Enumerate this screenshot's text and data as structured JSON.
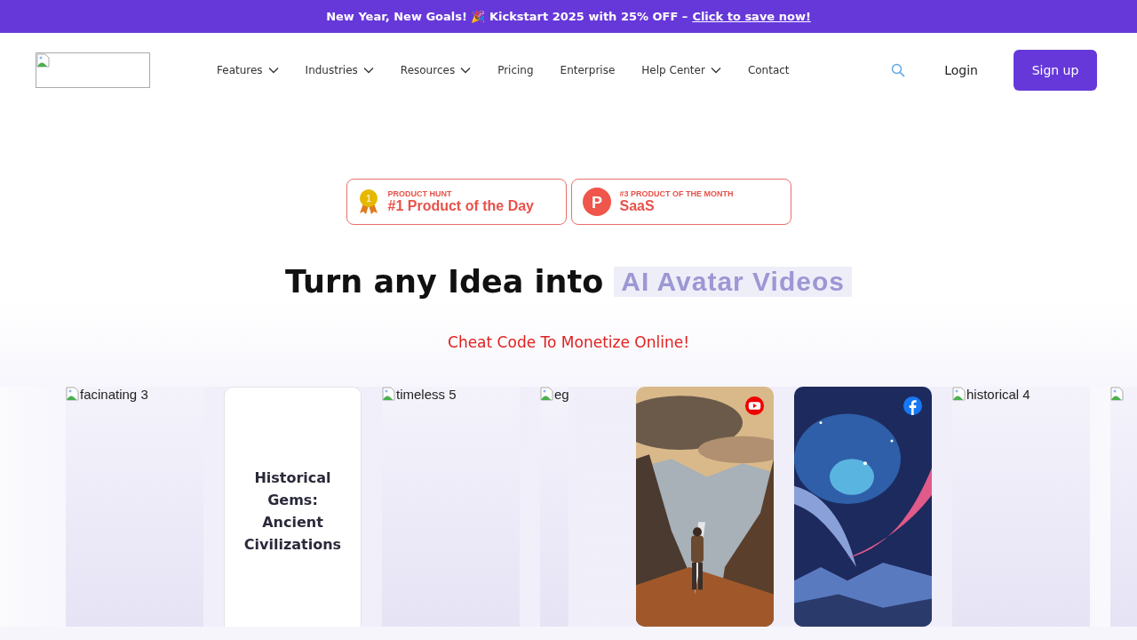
{
  "announcement": {
    "text": "New Year, New Goals! 🎉 Kickstart 2025 with 25% OFF –",
    "link": "Click to save now!"
  },
  "nav": {
    "items": [
      {
        "label": "Features",
        "dropdown": true
      },
      {
        "label": "Industries",
        "dropdown": true
      },
      {
        "label": "Resources",
        "dropdown": true
      },
      {
        "label": "Pricing",
        "dropdown": false
      },
      {
        "label": "Enterprise",
        "dropdown": false
      },
      {
        "label": "Help Center",
        "dropdown": true
      },
      {
        "label": "Contact",
        "dropdown": false
      }
    ],
    "login": "Login",
    "signup": "Sign up"
  },
  "awards": [
    {
      "kind": "medal",
      "eyebrow": "PRODUCT HUNT",
      "title": "#1 Product of the Day",
      "medal_number": "1"
    },
    {
      "kind": "producthunt",
      "eyebrow": "#3 PRODUCT OF THE MONTH",
      "title": "SaaS",
      "logo_letter": "P"
    }
  ],
  "hero": {
    "title": "Turn any Idea into",
    "highlight": "AI Avatar Videos",
    "subtitle": "Cheat Code To Monetize Online!"
  },
  "carousel_left": [
    {
      "kind": "broken-image",
      "alt": "facinating 3"
    },
    {
      "kind": "text-card",
      "title": "Historical Gems: Ancient Civilizations"
    },
    {
      "kind": "broken-image",
      "alt": "timeless 5"
    },
    {
      "kind": "broken-image",
      "alt": "eg"
    }
  ],
  "carousel_right": [
    {
      "kind": "youtube-clip"
    },
    {
      "kind": "facebook-clip"
    },
    {
      "kind": "broken-image",
      "alt": "historical 4"
    },
    {
      "kind": "broken-image"
    }
  ]
}
